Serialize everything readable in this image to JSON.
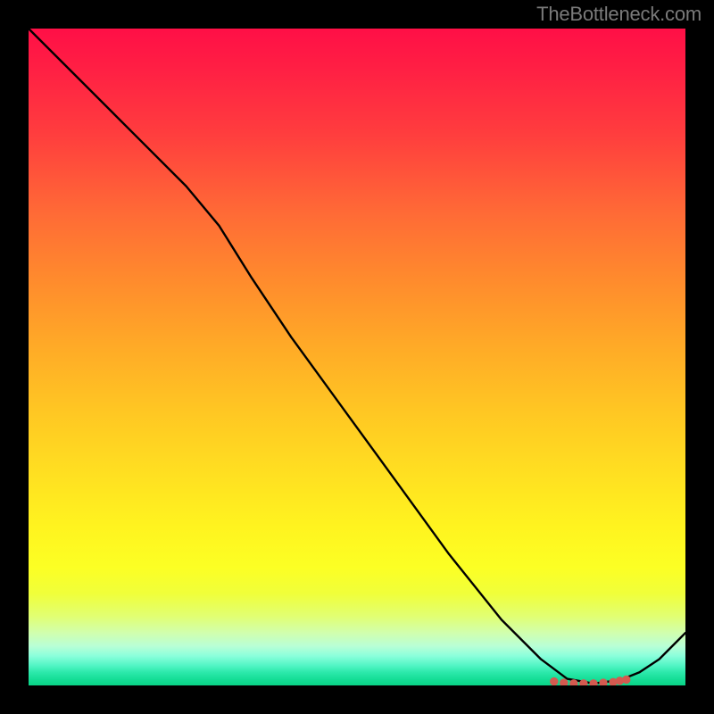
{
  "watermark": "TheBottleneck.com",
  "chart_data": {
    "type": "line",
    "title": "",
    "xlabel": "",
    "ylabel": "",
    "xlim": [
      0,
      100
    ],
    "ylim": [
      0,
      100
    ],
    "grid": false,
    "series": [
      {
        "name": "bottleneck-curve",
        "x": [
          0,
          8,
          16,
          24,
          29,
          34,
          40,
          48,
          56,
          64,
          72,
          78,
          82,
          86,
          90,
          93,
          96,
          100
        ],
        "y": [
          100,
          92,
          84,
          76,
          70,
          62,
          53,
          42,
          31,
          20,
          10,
          4,
          1,
          0.3,
          0.8,
          2,
          4,
          8
        ]
      }
    ],
    "markers": {
      "name": "optimal-cluster",
      "x": [
        80,
        81.5,
        83,
        84.5,
        86,
        87.5,
        89,
        90,
        91
      ],
      "y": [
        0.6,
        0.4,
        0.3,
        0.3,
        0.3,
        0.4,
        0.5,
        0.7,
        0.9
      ]
    },
    "gradient_stops": [
      {
        "pos": 0,
        "color": "#ff0f46"
      },
      {
        "pos": 50,
        "color": "#ffc623"
      },
      {
        "pos": 82,
        "color": "#fcff24"
      },
      {
        "pos": 100,
        "color": "#09d487"
      }
    ]
  }
}
